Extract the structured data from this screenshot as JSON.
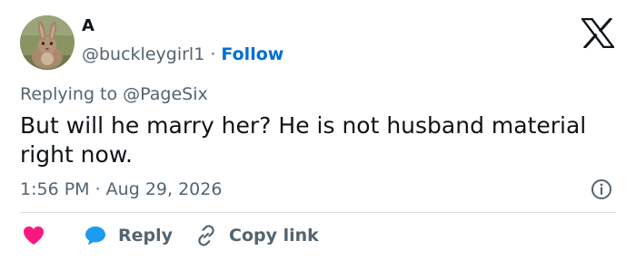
{
  "author": {
    "display_name": "A",
    "handle": "@buckleygirl1",
    "separator": " · ",
    "follow_label": "Follow"
  },
  "reply_context": {
    "prefix": "Replying to ",
    "mention": "@PageSix"
  },
  "tweet": {
    "text": "But will he marry her? He is not husband material right now.",
    "timestamp": "1:56 PM · Aug 29, 2026"
  },
  "actions": {
    "reply_label": "Reply",
    "copy_link_label": "Copy link"
  },
  "icons": {
    "brand": "x-logo-icon",
    "info": "info-icon",
    "like": "heart-icon",
    "reply": "speech-bubble-icon",
    "copy": "link-icon"
  },
  "colors": {
    "text": "#0f1419",
    "secondary_text": "#536471",
    "follow_link": "#006fd6",
    "heart": "#f91880",
    "reply_bubble": "#1d9bf0",
    "divider": "#cfd9de"
  }
}
